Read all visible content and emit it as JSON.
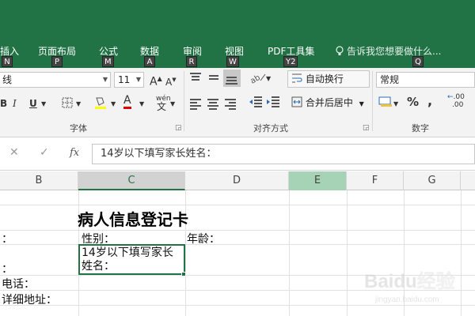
{
  "tabs": [
    {
      "label": "插入",
      "keytip": "N"
    },
    {
      "label": "页面布局",
      "keytip": "P"
    },
    {
      "label": "公式",
      "keytip": "M"
    },
    {
      "label": "数据",
      "keytip": "A"
    },
    {
      "label": "审阅",
      "keytip": "R"
    },
    {
      "label": "视图",
      "keytip": "W"
    },
    {
      "label": "PDF工具集",
      "keytip": "Y2"
    }
  ],
  "tell_me": {
    "text": "告诉我您想要做什么...",
    "keytip": "Q"
  },
  "ribbon": {
    "font_name": "线",
    "font_size": "11",
    "font_group_label": "字体",
    "align_group_label": "对齐方式",
    "number_group_label": "数字",
    "wrap_text": "自动换行",
    "merge_center": "合并后居中",
    "number_format": "常规",
    "bold": "B",
    "italic": "I",
    "underline": "U",
    "grow_font": "A",
    "shrink_font": "A",
    "font_color": "A",
    "wen": "wén",
    "percent": "%",
    "comma": ",",
    "dec_inc": ".00"
  },
  "formula_bar": {
    "cancel": "✕",
    "enter": "✓",
    "fx": "fx",
    "content": "14岁以下填写家长姓名："
  },
  "columns": [
    "B",
    "C",
    "D",
    "E",
    "F",
    "G"
  ],
  "cells": {
    "title": "病人信息登记卡",
    "b2": "：",
    "gender": "性别：",
    "age": "年龄：",
    "b3": "：",
    "active_cell": "14岁以下填写家长姓名：",
    "phone": "电话：",
    "address": "详细地址："
  },
  "watermark": {
    "text": "Baidu经验",
    "sub": "jingyan.baidu.com"
  },
  "colors": {
    "excel_green": "#217346",
    "active_column": "#a6d3b5"
  }
}
